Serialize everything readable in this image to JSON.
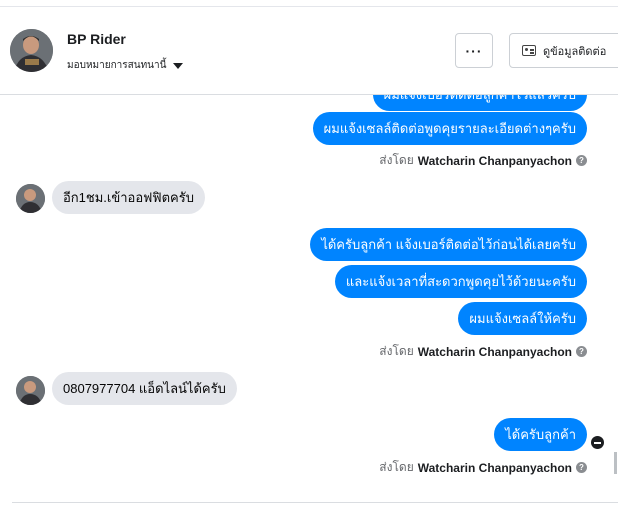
{
  "header": {
    "name": "BP Rider",
    "assign_label": "มอบหมายการสนทนานี้",
    "more_label": "···",
    "contact_label": "ดูข้อมูลติดต่อ"
  },
  "messages": {
    "out_partial": "ผมแจ้งเบอร์ติดต่อลูกค้าไว้แล้วครับ",
    "out_1": "ผมแจ้งเซลล์ติดต่อพูดคุยรายละเอียดต่างๆครับ",
    "in_1": "อีก1ชม.เข้าออฟฟิตครับ",
    "out_2": "ได้ครับลูกค้า แจ้งเบอร์ติดต่อไว้ก่อนได้เลยครับ",
    "out_3": "และแจ้งเวลาที่สะดวกพูดคุยไว้ด้วยนะครับ",
    "out_4": "ผมแจ้งเซลล์ให้ครับ",
    "in_2": "0807977704 แอ็ดไลน์ได้ครับ",
    "out_5": "ได้ครับลูกค้า"
  },
  "sent_by": {
    "prefix": "ส่งโดย",
    "agent": "Watcharin Chanpanyachon",
    "help": "?"
  },
  "icons": {
    "more": "more-horizontal-icon",
    "contact": "contact-card-icon",
    "caret": "caret-down-icon",
    "seen": "seen-avatar-icon"
  },
  "colors": {
    "outgoing": "#0084ff",
    "incoming": "#e4e6eb"
  }
}
